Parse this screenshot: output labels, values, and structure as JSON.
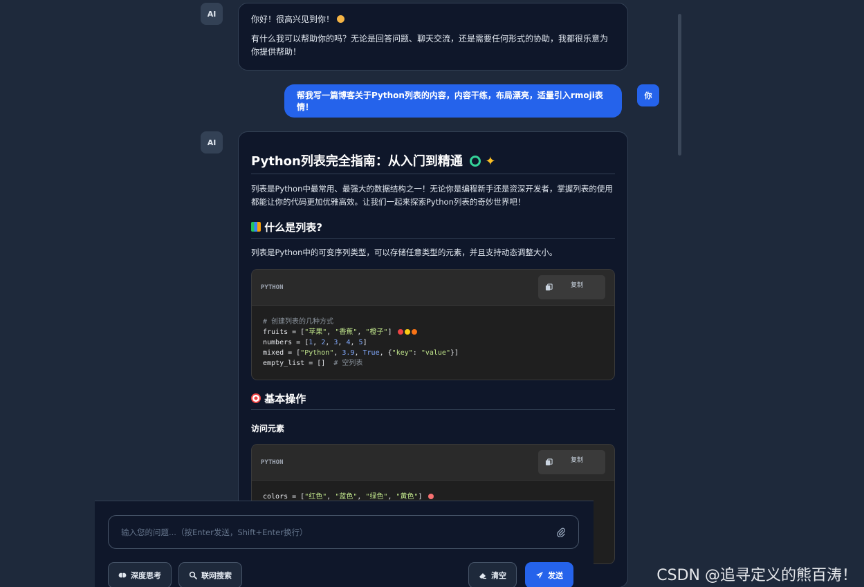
{
  "avatars": {
    "ai": "AI",
    "user": "你"
  },
  "messages": {
    "ai_greeting": {
      "line1": "你好！很高兴见到你！",
      "line2": "有什么我可以帮助你的吗？无论是回答问题、聊天交流，还是需要任何形式的协助，我都很乐意为你提供帮助！"
    },
    "user_request": "帮我写一篇博客关于Python列表的内容，内容干练，布局漂亮，适量引入rmoji表情！",
    "ai_article": {
      "title": "Python列表完全指南：从入门到精通",
      "intro": "列表是Python中最常用、最强大的数据结构之一！无论你是编程新手还是资深开发者，掌握列表的使用都能让你的代码更加优雅高效。让我们一起来探索Python列表的奇妙世界吧！",
      "section1_title": "什么是列表?",
      "section1_text": "列表是Python中的可变序列类型，可以存储任意类型的元素，并且支持动态调整大小。",
      "code1": {
        "lang": "PYTHON",
        "copy_label": "复制",
        "comment": "# 创建列表的几种方式",
        "fruits_prefix": "fruits = [",
        "fruit1": "\"苹果\"",
        "fruit2": "\"香蕉\"",
        "fruit3": "\"橙子\"",
        "numbers_prefix": "numbers = [",
        "n1": "1",
        "n2": "2",
        "n3": "3",
        "n4": "4",
        "n5": "5",
        "mixed_prefix": "mixed = [",
        "m1": "\"Python\"",
        "m2": "3.9",
        "m3": "True",
        "m4key": "\"key\"",
        "m4val": "\"value\"",
        "empty_line": "empty_list = []",
        "empty_comment": "# 空列表"
      },
      "section2_title": "基本操作",
      "section2_sub": "访问元素",
      "code2": {
        "lang": "PYTHON",
        "copy_label": "复制",
        "colors_prefix": "colors = [",
        "c1": "\"红色\"",
        "c2": "\"蓝色\"",
        "c3": "\"绿色\"",
        "c4": "\"黄色\""
      }
    }
  },
  "composer": {
    "placeholder": "输入您的问题...（按Enter发送，Shift+Enter换行）",
    "deep_think": "深度思考",
    "web_search": "联网搜索",
    "clear": "清空",
    "send": "发送"
  },
  "watermark": "CSDN @追寻定义的熊百涛！"
}
